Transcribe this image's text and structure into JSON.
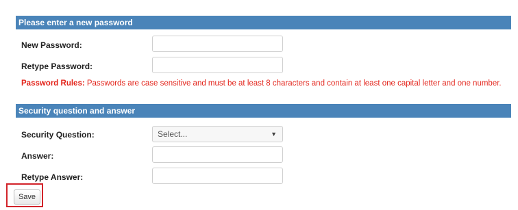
{
  "password_section": {
    "header": "Please enter a new password",
    "new_password_label": "New Password:",
    "new_password_value": "",
    "retype_password_label": "Retype Password:",
    "retype_password_value": "",
    "rules_title": "Password Rules:",
    "rules_text": " Passwords are case sensitive and must be at least 8 characters and contain at least one capital letter and one number."
  },
  "security_section": {
    "header": "Security question and answer",
    "question_label": "Security Question:",
    "question_selected": "Select...",
    "answer_label": "Answer:",
    "answer_value": "",
    "retype_answer_label": "Retype Answer:",
    "retype_answer_value": ""
  },
  "actions": {
    "save_label": "Save"
  },
  "colors": {
    "header_bg": "#4a84b9",
    "rules_text": "#e3241b",
    "highlight_border": "#d2232a"
  },
  "icons": {
    "select_chevron": "chevron-down-icon"
  }
}
